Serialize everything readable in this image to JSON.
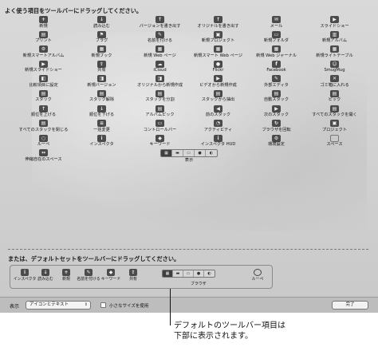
{
  "heading": "よく使う項目をツールバーにドラッグしてください。",
  "items": [
    {
      "label": "新規",
      "icon": "plus-icon",
      "glyph": "+"
    },
    {
      "label": "読み込む",
      "icon": "import-icon",
      "glyph": "↓"
    },
    {
      "label": "バージョンを書き出す",
      "icon": "export-version-icon",
      "glyph": "↑"
    },
    {
      "label": "オリジナルを書き出す",
      "icon": "export-original-icon",
      "glyph": "↑"
    },
    {
      "label": "メール",
      "icon": "mail-icon",
      "glyph": "✉"
    },
    {
      "label": "スライドショー",
      "icon": "slideshow-icon",
      "glyph": "▶"
    },
    {
      "label": "プリント",
      "icon": "print-icon",
      "glyph": "▤"
    },
    {
      "label": "フラグ",
      "icon": "flag-icon",
      "glyph": "⚑"
    },
    {
      "label": "名前を付ける",
      "icon": "name-icon",
      "glyph": "✎"
    },
    {
      "label": "新規プロジェクト",
      "icon": "new-project-icon",
      "glyph": "▣"
    },
    {
      "label": "新規フォルダ",
      "icon": "new-folder-icon",
      "glyph": "▭"
    },
    {
      "label": "新規アルバム",
      "icon": "new-album-icon",
      "glyph": "▥"
    },
    {
      "label": "新規スマートアルバム",
      "icon": "new-smart-album-icon",
      "glyph": "⚙"
    },
    {
      "label": "新規ブック",
      "icon": "new-book-icon",
      "glyph": "▦"
    },
    {
      "label": "新規 Web ページ",
      "icon": "new-web-page-icon",
      "glyph": "▦"
    },
    {
      "label": "新規スマート Web ページ",
      "icon": "new-smart-web-page-icon",
      "glyph": "▦"
    },
    {
      "label": "新規 Web ジャーナル",
      "icon": "new-web-journal-icon",
      "glyph": "▦"
    },
    {
      "label": "新規ライトテーブル",
      "icon": "new-light-table-icon",
      "glyph": "▦"
    },
    {
      "label": "新規スライドショー",
      "icon": "new-slideshow-icon",
      "glyph": "▶"
    },
    {
      "label": "共有",
      "icon": "share-icon",
      "glyph": "⇪"
    },
    {
      "label": "iCloud",
      "icon": "icloud-icon",
      "glyph": "☁"
    },
    {
      "label": "Flickr",
      "icon": "flickr-icon",
      "glyph": "●"
    },
    {
      "label": "Facebook",
      "icon": "facebook-icon",
      "glyph": "f"
    },
    {
      "label": "SmugMug",
      "icon": "smugmug-icon",
      "glyph": "☺"
    },
    {
      "label": "比較項目に設定",
      "icon": "set-compare-icon",
      "glyph": "◧"
    },
    {
      "label": "新規バージョン",
      "icon": "new-version-icon",
      "glyph": "◨"
    },
    {
      "label": "オリジナルから新規作成",
      "icon": "new-from-original-icon",
      "glyph": "◨"
    },
    {
      "label": "ビデオから新規作成",
      "icon": "new-from-video-icon",
      "glyph": "▶"
    },
    {
      "label": "外部エディタ",
      "icon": "external-editor-icon",
      "glyph": "✎"
    },
    {
      "label": "ゴミ箱に入れる",
      "icon": "trash-icon",
      "glyph": "✕"
    },
    {
      "label": "スタック",
      "icon": "stack-icon",
      "glyph": "▤"
    },
    {
      "label": "スタック解除",
      "icon": "unstack-icon",
      "glyph": "▤"
    },
    {
      "label": "スタックを分割",
      "icon": "split-stack-icon",
      "glyph": "▤"
    },
    {
      "label": "スタックから抽出",
      "icon": "extract-stack-icon",
      "glyph": "▤"
    },
    {
      "label": "自動スタック",
      "icon": "auto-stack-icon",
      "glyph": "▤"
    },
    {
      "label": "ピック",
      "icon": "pick-icon",
      "glyph": "▤"
    },
    {
      "label": "順位を上げる",
      "icon": "promote-icon",
      "glyph": "↑"
    },
    {
      "label": "順位を下げる",
      "icon": "demote-icon",
      "glyph": "↓"
    },
    {
      "label": "アルバムピック",
      "icon": "album-pick-icon",
      "glyph": "▤"
    },
    {
      "label": "前のスタック",
      "icon": "previous-stack-icon",
      "glyph": "◀"
    },
    {
      "label": "次のスタック",
      "icon": "next-stack-icon",
      "glyph": "▶"
    },
    {
      "label": "すべてのスタックを開く",
      "icon": "open-all-stacks-icon",
      "glyph": "▤"
    },
    {
      "label": "すべてのスタックを閉じる",
      "icon": "close-all-stacks-icon",
      "glyph": "▤"
    },
    {
      "label": "一括変更",
      "icon": "batch-change-icon",
      "glyph": "≡"
    },
    {
      "label": "コントロールバー",
      "icon": "control-bar-icon",
      "glyph": "▭"
    },
    {
      "label": "アクティビティ",
      "icon": "activity-icon",
      "glyph": "◔"
    },
    {
      "label": "ブラウザを回転",
      "icon": "rotate-browser-icon",
      "glyph": "↻"
    },
    {
      "label": "プロジェクト",
      "icon": "projects-icon",
      "glyph": "▣"
    },
    {
      "label": "ルーペ",
      "icon": "loupe-icon",
      "glyph": "○"
    },
    {
      "label": "インスペクタ",
      "icon": "inspector-icon",
      "glyph": "i"
    },
    {
      "label": "キーワード",
      "icon": "keyword-icon",
      "glyph": "◆"
    },
    {
      "label": "インスペクタ HUD",
      "icon": "inspector-hud-icon",
      "glyph": "i"
    },
    {
      "label": "環境設定",
      "icon": "preferences-icon",
      "glyph": "⚙"
    },
    {
      "label": "スペース",
      "icon": "space-icon",
      "glyph": ""
    },
    {
      "label": "伸縮自在のスペース",
      "icon": "flexible-space-icon",
      "glyph": "↔"
    }
  ],
  "view_segment": {
    "label": "表示"
  },
  "heading2": "または、デフォルトセットをツールバーにドラッグしてください。",
  "default_set": [
    {
      "label": "インスペクタ",
      "icon": "inspector-icon",
      "glyph": "i"
    },
    {
      "label": "読み込む",
      "icon": "import-icon",
      "glyph": "↓"
    },
    {
      "label": "新規",
      "icon": "plus-icon",
      "glyph": "+"
    },
    {
      "label": "名前を付ける",
      "icon": "name-icon",
      "glyph": "✎"
    },
    {
      "label": "キーワード",
      "icon": "keyword-icon",
      "glyph": "◆"
    },
    {
      "label": "共有",
      "icon": "share-icon",
      "glyph": "⇪"
    }
  ],
  "default_browser_label": "ブラウザ",
  "default_loupe_label": "ルーペ",
  "bottom": {
    "show_label": "表示",
    "show_value": "アイコンとテキスト",
    "small_size_label": "小さなサイズを使用",
    "done_label": "完了"
  },
  "callout": {
    "line1": "デフォルトのツールバー項目は",
    "line2": "下部に表示されます。"
  }
}
